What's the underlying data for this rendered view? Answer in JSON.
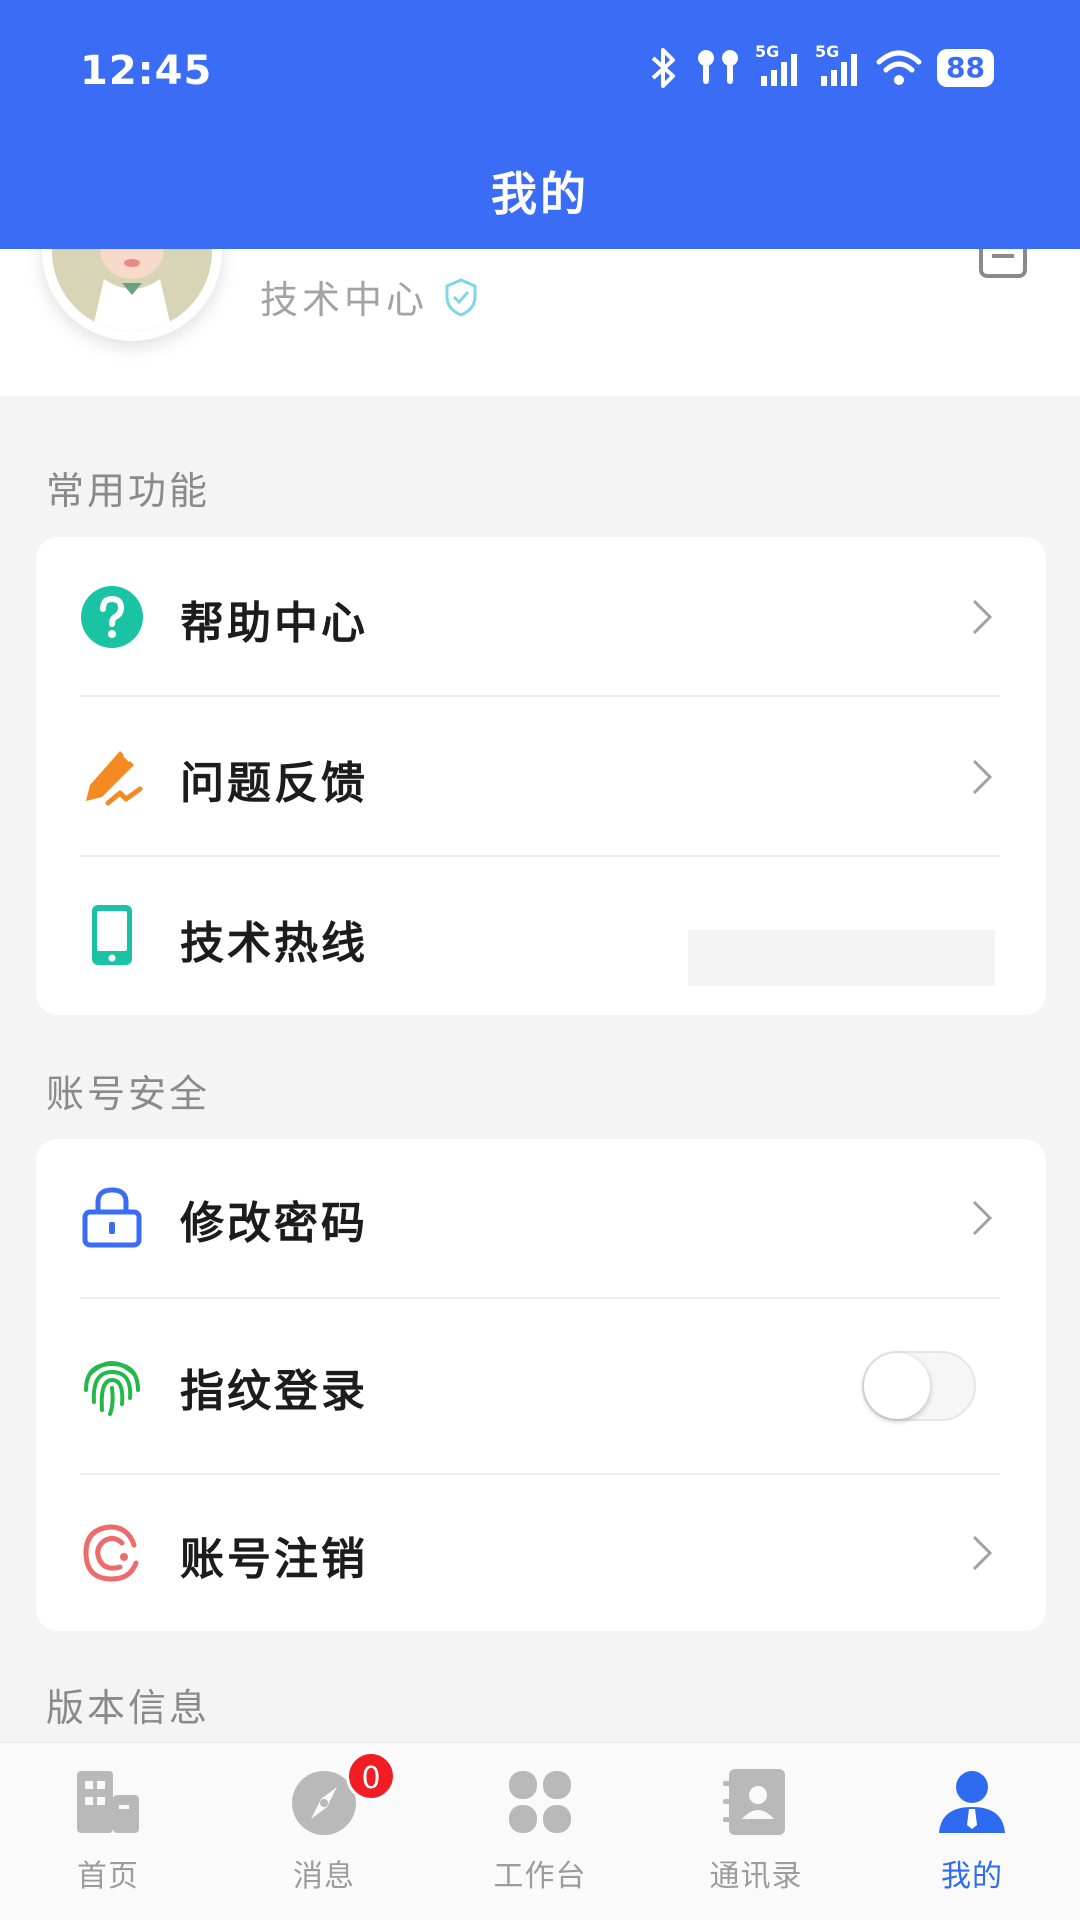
{
  "status_bar": {
    "time": "12:45",
    "battery": "88",
    "signal_label_1": "5G",
    "signal_label_2": "5G"
  },
  "header": {
    "title": "我的"
  },
  "profile": {
    "department": "技术中心"
  },
  "sections": {
    "common": {
      "label": "常用功能",
      "items": [
        {
          "label": "帮助中心",
          "icon": "question-circle-icon"
        },
        {
          "label": "问题反馈",
          "icon": "pencil-feedback-icon"
        },
        {
          "label": "技术热线",
          "icon": "phone-icon"
        }
      ]
    },
    "account": {
      "label": "账号安全",
      "items": [
        {
          "label": "修改密码",
          "icon": "lock-icon"
        },
        {
          "label": "指纹登录",
          "icon": "fingerprint-icon",
          "toggle_on": false
        },
        {
          "label": "账号注销",
          "icon": "logout-circle-icon"
        }
      ]
    },
    "version": {
      "label": "版本信息"
    }
  },
  "tabbar": {
    "tabs": [
      {
        "label": "首页",
        "icon": "building-icon"
      },
      {
        "label": "消息",
        "icon": "compass-icon",
        "badge": "0"
      },
      {
        "label": "工作台",
        "icon": "grid-icon"
      },
      {
        "label": "通讯录",
        "icon": "contacts-icon"
      },
      {
        "label": "我的",
        "icon": "person-icon",
        "active": true
      }
    ]
  },
  "colors": {
    "primary": "#3b6cf6",
    "teal": "#19c3a4",
    "orange": "#f58a23",
    "green": "#22b84a",
    "red": "#ef6b6b",
    "badge": "#f21d24"
  }
}
